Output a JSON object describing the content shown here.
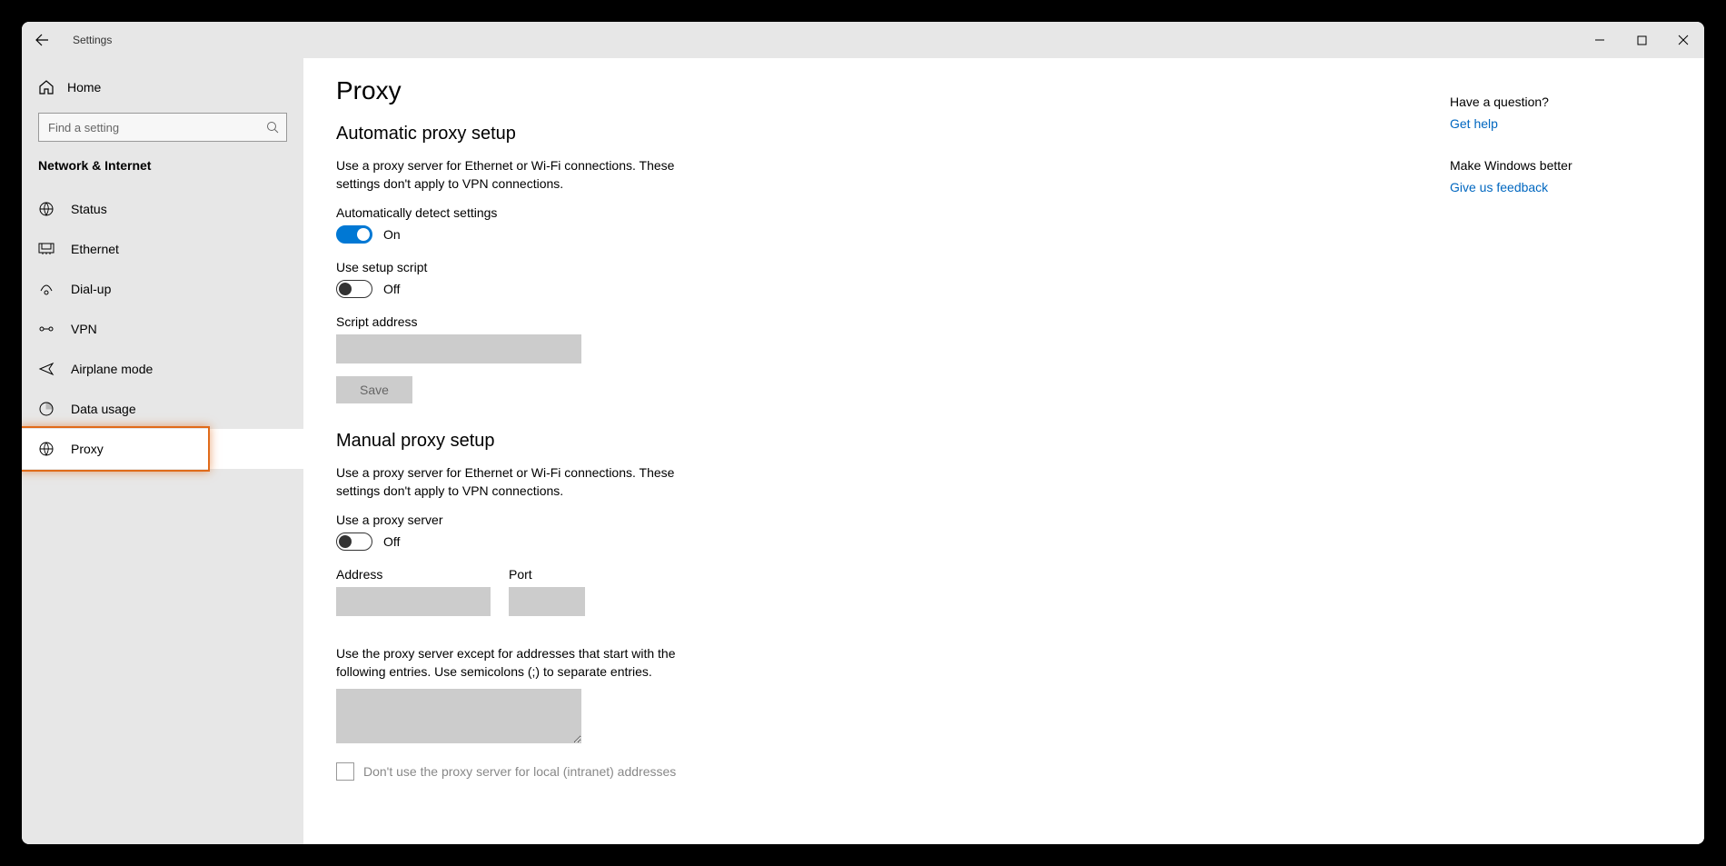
{
  "window": {
    "title": "Settings",
    "back_icon": "back-arrow-icon",
    "minimize_icon": "minimize-icon",
    "maximize_icon": "maximize-icon",
    "close_icon": "close-icon"
  },
  "sidebar": {
    "home_label": "Home",
    "search_placeholder": "Find a setting",
    "category_label": "Network & Internet",
    "items": [
      {
        "icon": "status-icon",
        "label": "Status"
      },
      {
        "icon": "ethernet-icon",
        "label": "Ethernet"
      },
      {
        "icon": "dialup-icon",
        "label": "Dial-up"
      },
      {
        "icon": "vpn-icon",
        "label": "VPN"
      },
      {
        "icon": "airplane-icon",
        "label": "Airplane mode"
      },
      {
        "icon": "datausage-icon",
        "label": "Data usage"
      },
      {
        "icon": "proxy-icon",
        "label": "Proxy"
      }
    ],
    "active_index": 6
  },
  "main": {
    "page_title": "Proxy",
    "auto": {
      "section_title": "Automatic proxy setup",
      "description": "Use a proxy server for Ethernet or Wi-Fi connections. These settings don't apply to VPN connections.",
      "auto_detect_label": "Automatically detect settings",
      "auto_detect_state": "On",
      "setup_script_label": "Use setup script",
      "setup_script_state": "Off",
      "script_address_label": "Script address",
      "save_label": "Save"
    },
    "manual": {
      "section_title": "Manual proxy setup",
      "description": "Use a proxy server for Ethernet or Wi-Fi connections. These settings don't apply to VPN connections.",
      "use_proxy_label": "Use a proxy server",
      "use_proxy_state": "Off",
      "address_label": "Address",
      "port_label": "Port",
      "exceptions_label": "Use the proxy server except for addresses that start with the following entries. Use semicolons (;) to separate entries.",
      "local_checkbox_label": "Don't use the proxy server for local (intranet) addresses"
    }
  },
  "right_panel": {
    "question_heading": "Have a question?",
    "help_link": "Get help",
    "better_heading": "Make Windows better",
    "feedback_link": "Give us feedback"
  }
}
